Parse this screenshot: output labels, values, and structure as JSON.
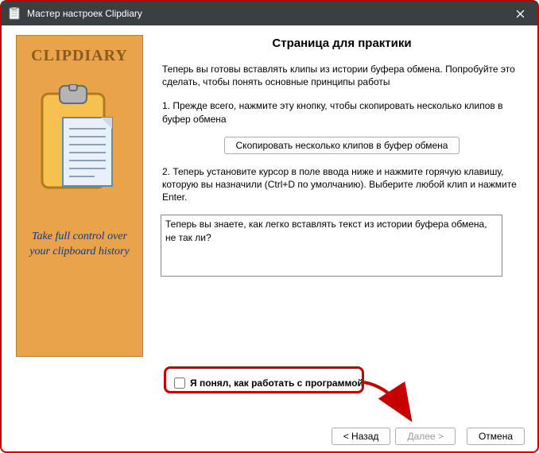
{
  "window": {
    "title": "Мастер настроек Clipdiary"
  },
  "sidebar": {
    "logo": "CLIPDIARY",
    "tagline": "Take full control over your clipboard history"
  },
  "main": {
    "heading": "Страница для практики",
    "intro": "Теперь вы готовы вставлять клипы из истории буфера обмена. Попробуйте это сделать, чтобы понять основные принципы работы",
    "step1": "1. Прежде всего, нажмите эту кнопку, чтобы скопировать несколько клипов в буфер обмена",
    "copy_button": "Скопировать несколько клипов в буфер обмена",
    "step2": "2. Теперь установите курсор в поле ввода ниже и нажмите горячую клавишу, которую вы назначили (Ctrl+D по умолчанию). Выберите любой клип и нажмите Enter.",
    "textarea_value": "Теперь вы знаете, как легко вставлять текст из истории буфера обмена, не так ли?"
  },
  "checkbox": {
    "label": "Я понял, как работать с программой",
    "checked": false
  },
  "buttons": {
    "back": "< Назад",
    "next": "Далее >",
    "cancel": "Отмена"
  }
}
